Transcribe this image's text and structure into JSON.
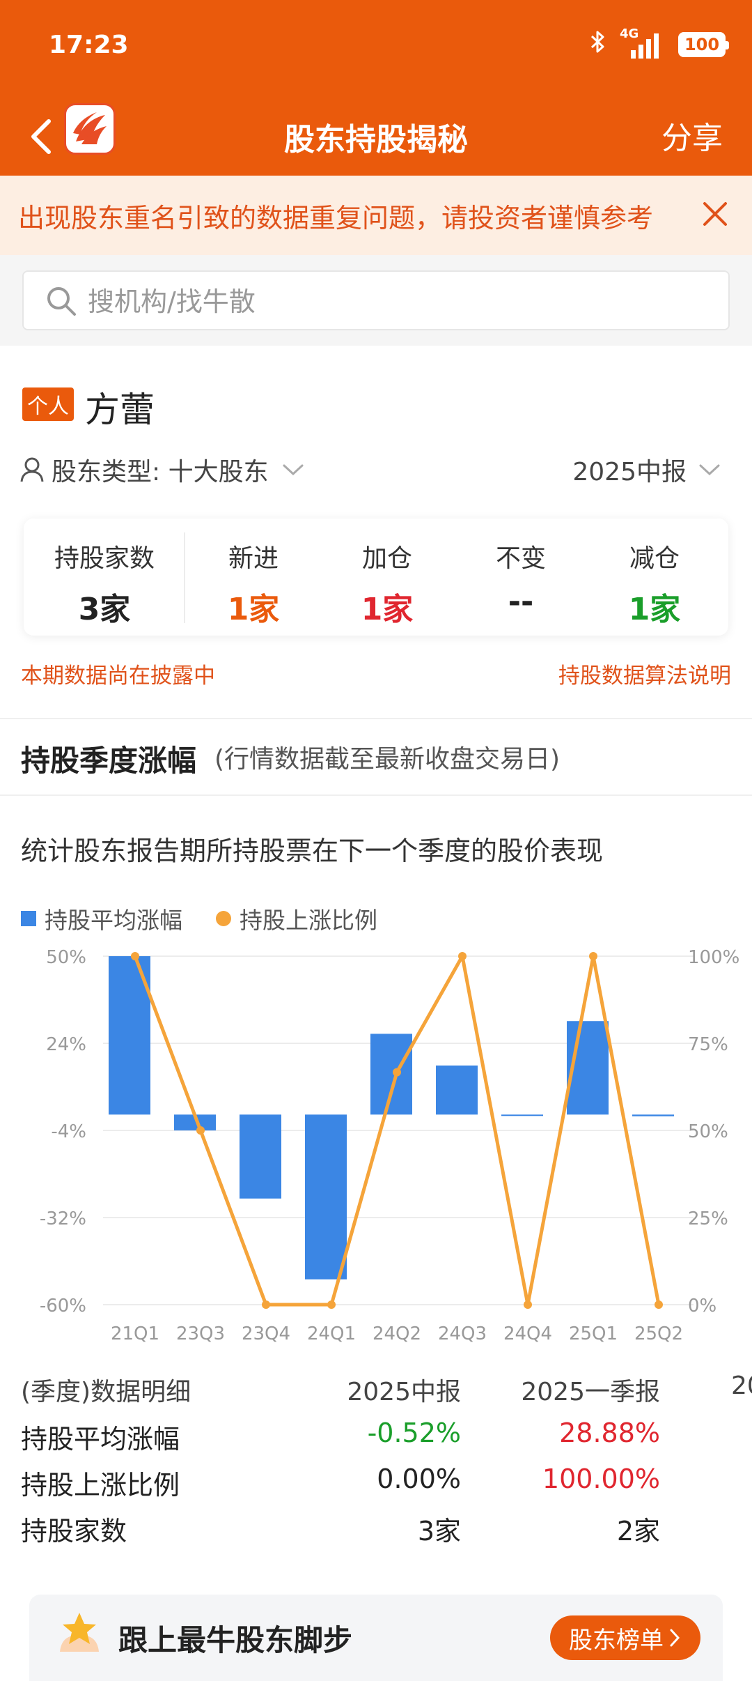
{
  "status_bar": {
    "time": "17:23",
    "network": "4G",
    "battery": "100"
  },
  "nav": {
    "title": "股东持股揭秘",
    "share_label": "分享"
  },
  "notice": {
    "text": "出现股东重名引致的数据重复问题，请投资者谨慎参考"
  },
  "search": {
    "placeholder": "搜机构/找牛散"
  },
  "profile": {
    "tag": "个人",
    "name": "方蕾",
    "type_label": "股东类型: 十大股东",
    "period": "2025中报"
  },
  "stats": {
    "holdings": {
      "label": "持股家数",
      "value": "3家"
    },
    "new": {
      "label": "新进",
      "value": "1家"
    },
    "add": {
      "label": "加仓",
      "value": "1家"
    },
    "same": {
      "label": "不变",
      "value": "--"
    },
    "reduce": {
      "label": "减仓",
      "value": "1家"
    }
  },
  "footer_links": {
    "left": "本期数据尚在披露中",
    "right": "持股数据算法说明"
  },
  "section": {
    "title": "持股季度涨幅",
    "subtitle": "(行情数据截至最新收盘交易日)",
    "description": "统计股东报告期所持股票在下一个季度的股价表现"
  },
  "colors": {
    "accent": "#ea5a0c",
    "bar": "#3b86e4",
    "line": "#f5a43a",
    "up": "#e0262f",
    "down": "#1a9e2a"
  },
  "chart_data": {
    "type": "bar",
    "categories": [
      "21Q1",
      "23Q3",
      "23Q4",
      "24Q1",
      "24Q2",
      "24Q3",
      "24Q4",
      "25Q1",
      "25Q2"
    ],
    "series": [
      {
        "name": "持股平均涨幅",
        "type": "bar",
        "axis": "left",
        "values": [
          50,
          -5,
          -26.5,
          -52,
          25.5,
          15.5,
          0,
          29.5,
          -0.52
        ]
      },
      {
        "name": "持股上涨比例",
        "type": "line",
        "axis": "right",
        "values": [
          100,
          50,
          0,
          0,
          66.7,
          100,
          0,
          100,
          0
        ]
      }
    ],
    "y_left": {
      "ticks": [
        "50%",
        "24%",
        "-4%",
        "-32%",
        "-60%"
      ],
      "ylim": [
        -60,
        50
      ]
    },
    "y_right": {
      "ticks": [
        "100%",
        "75%",
        "50%",
        "25%",
        "0%"
      ],
      "ylim": [
        0,
        100
      ]
    },
    "legend_position": "top-left",
    "grid": true
  },
  "table": {
    "header": {
      "label": "(季度)数据明细",
      "col1": "2025中报",
      "col2": "2025一季报",
      "col3": "20"
    },
    "rows": [
      {
        "label": "持股平均涨幅",
        "col1": "-0.52%",
        "col2": "28.88%"
      },
      {
        "label": "持股上涨比例",
        "col1": "0.00%",
        "col2": "100.00%"
      },
      {
        "label": "持股家数",
        "col1": "3家",
        "col2": "2家"
      }
    ]
  },
  "promo": {
    "text": "跟上最牛股东脚步",
    "button": "股东榜单"
  }
}
